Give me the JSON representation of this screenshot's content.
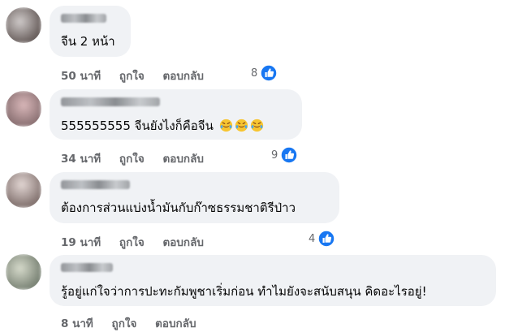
{
  "comments": [
    {
      "name": "auto-blurred",
      "text": "จีน 2 หน้า",
      "time": "50 นาที",
      "like_action": "ถูกใจ",
      "reply_action": "ตอบกลับ",
      "like_count": "8"
    },
    {
      "name": "Shinawang Ningsa",
      "text": "555555555 จีนยังไงก็คือจีน",
      "emoji": [
        "rofl-emoji",
        "rofl-emoji",
        "rofl-emoji"
      ],
      "time": "34 นาที",
      "like_action": "ถูกใจ",
      "reply_action": "ตอบกลับ",
      "like_count": "9"
    },
    {
      "name": "Kop Sallong",
      "text": "ต้องการส่วนแบ่งน้ำมันกับก๊าซธรรมชาติรีป่าว",
      "time": "19 นาที",
      "like_action": "ถูกใจ",
      "reply_action": "ตอบกลับ",
      "like_count": "4"
    },
    {
      "name": "Ann Ruen",
      "text": "รู้อยู่แก่ใจว่าการปะทะกัมพูชาเริ่มก่อน ทำไมยังจะสนับสนุน คิดอะไรอยู่!",
      "time": "8 นาที",
      "like_action": "ถูกใจ",
      "reply_action": "ตอบกลับ"
    }
  ],
  "colors": {
    "bubble": "#f0f2f5",
    "meta": "#65676b",
    "like_blue": "#1877f2"
  }
}
